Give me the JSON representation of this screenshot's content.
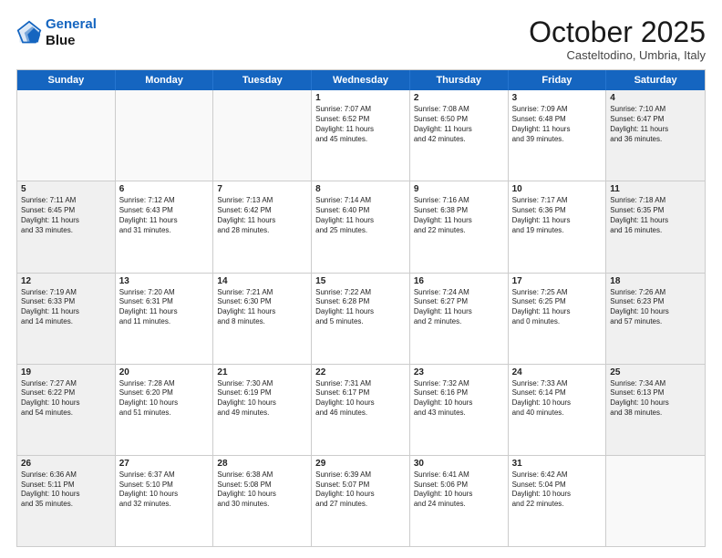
{
  "logo": {
    "line1": "General",
    "line2": "Blue"
  },
  "title": "October 2025",
  "location": "Casteltodino, Umbria, Italy",
  "header_days": [
    "Sunday",
    "Monday",
    "Tuesday",
    "Wednesday",
    "Thursday",
    "Friday",
    "Saturday"
  ],
  "weeks": [
    [
      {
        "day": "",
        "text": "",
        "empty": true
      },
      {
        "day": "",
        "text": "",
        "empty": true
      },
      {
        "day": "",
        "text": "",
        "empty": true
      },
      {
        "day": "1",
        "text": "Sunrise: 7:07 AM\nSunset: 6:52 PM\nDaylight: 11 hours\nand 45 minutes.",
        "empty": false
      },
      {
        "day": "2",
        "text": "Sunrise: 7:08 AM\nSunset: 6:50 PM\nDaylight: 11 hours\nand 42 minutes.",
        "empty": false
      },
      {
        "day": "3",
        "text": "Sunrise: 7:09 AM\nSunset: 6:48 PM\nDaylight: 11 hours\nand 39 minutes.",
        "empty": false
      },
      {
        "day": "4",
        "text": "Sunrise: 7:10 AM\nSunset: 6:47 PM\nDaylight: 11 hours\nand 36 minutes.",
        "empty": false,
        "shaded": true
      }
    ],
    [
      {
        "day": "5",
        "text": "Sunrise: 7:11 AM\nSunset: 6:45 PM\nDaylight: 11 hours\nand 33 minutes.",
        "empty": false,
        "shaded": true
      },
      {
        "day": "6",
        "text": "Sunrise: 7:12 AM\nSunset: 6:43 PM\nDaylight: 11 hours\nand 31 minutes.",
        "empty": false
      },
      {
        "day": "7",
        "text": "Sunrise: 7:13 AM\nSunset: 6:42 PM\nDaylight: 11 hours\nand 28 minutes.",
        "empty": false
      },
      {
        "day": "8",
        "text": "Sunrise: 7:14 AM\nSunset: 6:40 PM\nDaylight: 11 hours\nand 25 minutes.",
        "empty": false
      },
      {
        "day": "9",
        "text": "Sunrise: 7:16 AM\nSunset: 6:38 PM\nDaylight: 11 hours\nand 22 minutes.",
        "empty": false
      },
      {
        "day": "10",
        "text": "Sunrise: 7:17 AM\nSunset: 6:36 PM\nDaylight: 11 hours\nand 19 minutes.",
        "empty": false
      },
      {
        "day": "11",
        "text": "Sunrise: 7:18 AM\nSunset: 6:35 PM\nDaylight: 11 hours\nand 16 minutes.",
        "empty": false,
        "shaded": true
      }
    ],
    [
      {
        "day": "12",
        "text": "Sunrise: 7:19 AM\nSunset: 6:33 PM\nDaylight: 11 hours\nand 14 minutes.",
        "empty": false,
        "shaded": true
      },
      {
        "day": "13",
        "text": "Sunrise: 7:20 AM\nSunset: 6:31 PM\nDaylight: 11 hours\nand 11 minutes.",
        "empty": false
      },
      {
        "day": "14",
        "text": "Sunrise: 7:21 AM\nSunset: 6:30 PM\nDaylight: 11 hours\nand 8 minutes.",
        "empty": false
      },
      {
        "day": "15",
        "text": "Sunrise: 7:22 AM\nSunset: 6:28 PM\nDaylight: 11 hours\nand 5 minutes.",
        "empty": false
      },
      {
        "day": "16",
        "text": "Sunrise: 7:24 AM\nSunset: 6:27 PM\nDaylight: 11 hours\nand 2 minutes.",
        "empty": false
      },
      {
        "day": "17",
        "text": "Sunrise: 7:25 AM\nSunset: 6:25 PM\nDaylight: 11 hours\nand 0 minutes.",
        "empty": false
      },
      {
        "day": "18",
        "text": "Sunrise: 7:26 AM\nSunset: 6:23 PM\nDaylight: 10 hours\nand 57 minutes.",
        "empty": false,
        "shaded": true
      }
    ],
    [
      {
        "day": "19",
        "text": "Sunrise: 7:27 AM\nSunset: 6:22 PM\nDaylight: 10 hours\nand 54 minutes.",
        "empty": false,
        "shaded": true
      },
      {
        "day": "20",
        "text": "Sunrise: 7:28 AM\nSunset: 6:20 PM\nDaylight: 10 hours\nand 51 minutes.",
        "empty": false
      },
      {
        "day": "21",
        "text": "Sunrise: 7:30 AM\nSunset: 6:19 PM\nDaylight: 10 hours\nand 49 minutes.",
        "empty": false
      },
      {
        "day": "22",
        "text": "Sunrise: 7:31 AM\nSunset: 6:17 PM\nDaylight: 10 hours\nand 46 minutes.",
        "empty": false
      },
      {
        "day": "23",
        "text": "Sunrise: 7:32 AM\nSunset: 6:16 PM\nDaylight: 10 hours\nand 43 minutes.",
        "empty": false
      },
      {
        "day": "24",
        "text": "Sunrise: 7:33 AM\nSunset: 6:14 PM\nDaylight: 10 hours\nand 40 minutes.",
        "empty": false
      },
      {
        "day": "25",
        "text": "Sunrise: 7:34 AM\nSunset: 6:13 PM\nDaylight: 10 hours\nand 38 minutes.",
        "empty": false,
        "shaded": true
      }
    ],
    [
      {
        "day": "26",
        "text": "Sunrise: 6:36 AM\nSunset: 5:11 PM\nDaylight: 10 hours\nand 35 minutes.",
        "empty": false,
        "shaded": true
      },
      {
        "day": "27",
        "text": "Sunrise: 6:37 AM\nSunset: 5:10 PM\nDaylight: 10 hours\nand 32 minutes.",
        "empty": false
      },
      {
        "day": "28",
        "text": "Sunrise: 6:38 AM\nSunset: 5:08 PM\nDaylight: 10 hours\nand 30 minutes.",
        "empty": false
      },
      {
        "day": "29",
        "text": "Sunrise: 6:39 AM\nSunset: 5:07 PM\nDaylight: 10 hours\nand 27 minutes.",
        "empty": false
      },
      {
        "day": "30",
        "text": "Sunrise: 6:41 AM\nSunset: 5:06 PM\nDaylight: 10 hours\nand 24 minutes.",
        "empty": false
      },
      {
        "day": "31",
        "text": "Sunrise: 6:42 AM\nSunset: 5:04 PM\nDaylight: 10 hours\nand 22 minutes.",
        "empty": false
      },
      {
        "day": "",
        "text": "",
        "empty": true,
        "shaded": true
      }
    ]
  ]
}
